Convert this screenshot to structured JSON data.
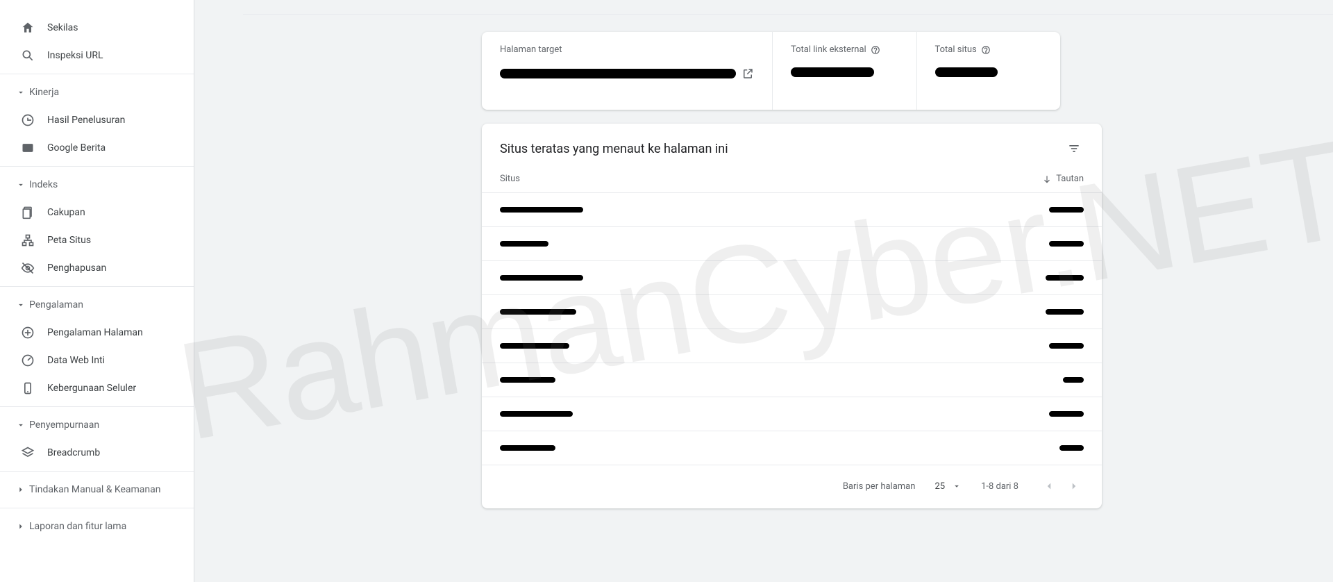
{
  "sidebar": {
    "items": {
      "overview": "Sekilas",
      "inspect": "Inspeksi URL"
    },
    "sections": {
      "performance": {
        "label": "Kinerja",
        "items": {
          "search_results": "Hasil Penelusuran",
          "google_news": "Google Berita"
        }
      },
      "index": {
        "label": "Indeks",
        "items": {
          "coverage": "Cakupan",
          "sitemaps": "Peta Situs",
          "removals": "Penghapusan"
        }
      },
      "experience": {
        "label": "Pengalaman",
        "items": {
          "page_experience": "Pengalaman Halaman",
          "core_web_vitals": "Data Web Inti",
          "mobile_usability": "Kebergunaan Seluler"
        }
      },
      "enhancements": {
        "label": "Penyempurnaan",
        "items": {
          "breadcrumbs": "Breadcrumb"
        }
      },
      "security": {
        "label": "Tindakan Manual & Keamanan"
      },
      "legacy": {
        "label": "Laporan dan fitur lama"
      }
    }
  },
  "summary": {
    "target_page_label": "Halaman target",
    "external_links_label": "Total link eksternal",
    "total_sites_label": "Total situs"
  },
  "table": {
    "title": "Situs teratas yang menaut ke halaman ini",
    "col_site": "Situs",
    "col_links": "Tautan",
    "row_count": 8,
    "rows_per_page_label": "Baris per halaman",
    "rows_per_page_value": "25",
    "range_label": "1-8 dari 8"
  },
  "watermark": "RahmanCyber.NET"
}
